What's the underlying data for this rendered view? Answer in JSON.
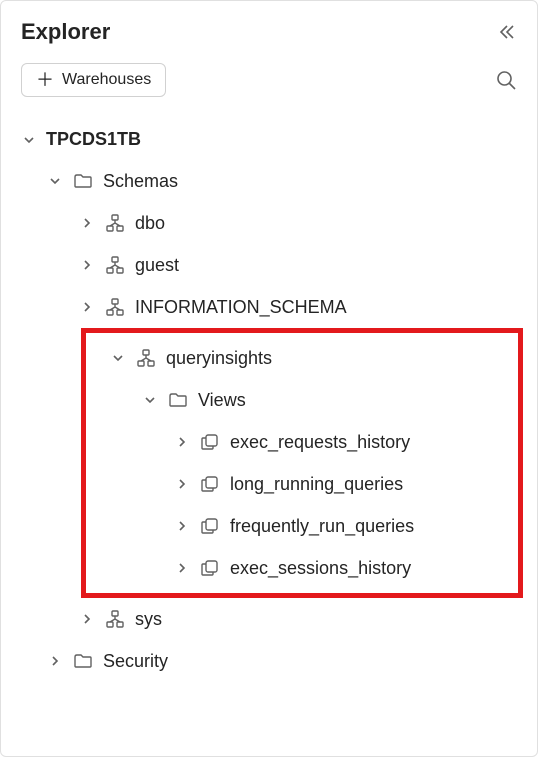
{
  "header": {
    "title": "Explorer"
  },
  "toolbar": {
    "warehouses_label": "Warehouses"
  },
  "tree": {
    "database": "TPCDS1TB",
    "schemas_label": "Schemas",
    "schemas": {
      "dbo": "dbo",
      "guest": "guest",
      "information_schema": "INFORMATION_SCHEMA",
      "queryinsights": {
        "label": "queryinsights",
        "views_label": "Views",
        "views": [
          "exec_requests_history",
          "long_running_queries",
          "frequently_run_queries",
          "exec_sessions_history"
        ]
      },
      "sys": "sys"
    },
    "security_label": "Security"
  }
}
